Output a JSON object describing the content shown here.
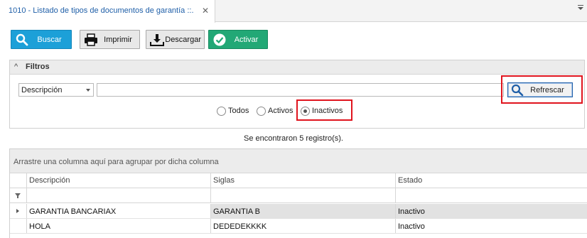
{
  "tab": {
    "title": "1010 - Listado de tipos de documentos de garantía ::.",
    "close_glyph": "✕"
  },
  "toolbar": {
    "buscar_label": "Buscar",
    "imprimir_label": "Imprimir",
    "descargar_label": "Descargar",
    "activar_label": "Activar",
    "colors": {
      "buscar": "#1ca0d8",
      "activar": "#22a876"
    }
  },
  "filters": {
    "title": "Filtros",
    "field_select": "Descripción",
    "search_value": "",
    "refresh_label": "Refrescar",
    "radios": [
      {
        "label": "Todos",
        "checked": false
      },
      {
        "label": "Activos",
        "checked": false
      },
      {
        "label": "Inactivos",
        "checked": true
      }
    ]
  },
  "records_text": "Se encontraron 5 registro(s).",
  "grid": {
    "group_hint": "Arrastre una columna aquí para agrupar por dicha columna",
    "columns": [
      "Descripción",
      "Siglas",
      "Estado"
    ],
    "rows": [
      {
        "descripcion": "GARANTIA BANCARIAX",
        "siglas": "GARANTIA B",
        "estado": "Inactivo"
      },
      {
        "descripcion": "HOLA",
        "siglas": "DEDEDEKKKK",
        "estado": "Inactivo"
      }
    ]
  },
  "highlight_color": "#e0141e"
}
